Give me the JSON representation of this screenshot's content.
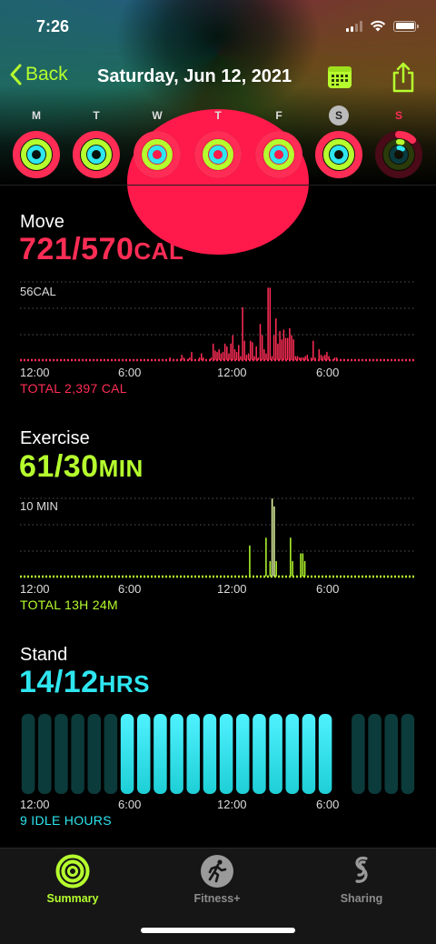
{
  "status_bar": {
    "time": "7:26"
  },
  "nav": {
    "back_label": "Back",
    "title": "Saturday, Jun 12, 2021"
  },
  "week": {
    "days": [
      {
        "letter": "M",
        "state": "complete"
      },
      {
        "letter": "T",
        "state": "complete"
      },
      {
        "letter": "W",
        "state": "complete"
      },
      {
        "letter": "T",
        "state": "complete"
      },
      {
        "letter": "F",
        "state": "complete"
      },
      {
        "letter": "S",
        "state": "selected"
      },
      {
        "letter": "S",
        "state": "today"
      }
    ]
  },
  "move": {
    "title": "Move",
    "value": "721/570",
    "unit": "CAL",
    "scale_label": "56CAL",
    "total": "TOTAL 2,397 CAL",
    "x_ticks": [
      "12:00",
      "6:00",
      "12:00",
      "6:00"
    ],
    "color": "#ff2d55"
  },
  "exercise": {
    "title": "Exercise",
    "value": "61/30",
    "unit": "MIN",
    "scale_label": "10 MIN",
    "total": "TOTAL 13H 24M",
    "x_ticks": [
      "12:00",
      "6:00",
      "12:00",
      "6:00"
    ],
    "color": "#b6ff2e"
  },
  "stand": {
    "title": "Stand",
    "value": "14/12",
    "unit": "HRS",
    "idle": "9 IDLE HOURS",
    "x_ticks": [
      "12:00",
      "6:00",
      "12:00",
      "6:00"
    ],
    "color": "#2ee6f0"
  },
  "chart_data": [
    {
      "type": "bar",
      "name": "Move",
      "unit": "CAL",
      "interval_minutes": 15,
      "ylim": [
        0,
        56
      ],
      "values": [
        0,
        0,
        0,
        0,
        0,
        0,
        0,
        0,
        0,
        0,
        0,
        0,
        0,
        0,
        0,
        0,
        0,
        0,
        0,
        0,
        0,
        0,
        0,
        0,
        0,
        0,
        0,
        0,
        0,
        0,
        0,
        0,
        0,
        0,
        0,
        0,
        0,
        0,
        0,
        0,
        0,
        0,
        0,
        0,
        0,
        0,
        0,
        0,
        0,
        0,
        0,
        0,
        0,
        0,
        0,
        0,
        0,
        0,
        0,
        0,
        0,
        0,
        0,
        0,
        0,
        0,
        0,
        0,
        0,
        0,
        0,
        0,
        0,
        1,
        1,
        1,
        2,
        0,
        0,
        1,
        1,
        1,
        4,
        2,
        1,
        1,
        2,
        6,
        1,
        0,
        0,
        2,
        5,
        2,
        1,
        1,
        1,
        2,
        12,
        7,
        6,
        8,
        5,
        6,
        12,
        10,
        5,
        12,
        18,
        8,
        6,
        11,
        3,
        38,
        14,
        4,
        5,
        14,
        13,
        3,
        10,
        2,
        26,
        18,
        8,
        5,
        52,
        52,
        3,
        18,
        30,
        12,
        21,
        15,
        22,
        16,
        16,
        23,
        18,
        15,
        3,
        3,
        2,
        2,
        2,
        3,
        4,
        1,
        2,
        14,
        2,
        1,
        8,
        4,
        3,
        4,
        6,
        3,
        1,
        1,
        2,
        2,
        1,
        1,
        1,
        1,
        1,
        1,
        1,
        1,
        1,
        1,
        1,
        1,
        1,
        1,
        1,
        1,
        1,
        1,
        1,
        1,
        1,
        1,
        1,
        1,
        1,
        1,
        1,
        1,
        1,
        1,
        1,
        1,
        1,
        1,
        1,
        1,
        1,
        1,
        1,
        1
      ],
      "x_ticks": [
        "12:00",
        "6:00",
        "12:00",
        "6:00"
      ]
    },
    {
      "type": "bar",
      "name": "Exercise",
      "unit": "MIN",
      "interval_minutes": 15,
      "ylim": [
        0,
        10
      ],
      "values": [
        0,
        0,
        0,
        0,
        0,
        0,
        0,
        0,
        0,
        0,
        0,
        0,
        0,
        0,
        0,
        0,
        0,
        0,
        0,
        0,
        0,
        0,
        0,
        0,
        0,
        0,
        0,
        0,
        0,
        0,
        0,
        0,
        0,
        0,
        0,
        0,
        0,
        0,
        0,
        0,
        0,
        0,
        0,
        0,
        0,
        0,
        0,
        0,
        0,
        0,
        0,
        0,
        0,
        0,
        0,
        0,
        0,
        0,
        0,
        0,
        0,
        0,
        0,
        0,
        0,
        0,
        0,
        0,
        0,
        0,
        0,
        0,
        0,
        0,
        0,
        0,
        0,
        0,
        0,
        0,
        0,
        0,
        0,
        0,
        0,
        0,
        0,
        0,
        0,
        0,
        0,
        0,
        0,
        0,
        0,
        0,
        0,
        0,
        0,
        0,
        0,
        0,
        0,
        0,
        0,
        0,
        0,
        0,
        0,
        0,
        0,
        0,
        4,
        1,
        0,
        0,
        0,
        0,
        0,
        0,
        5,
        0,
        2,
        10,
        9,
        2,
        0,
        0,
        0,
        0,
        0,
        0,
        5,
        2,
        0,
        0,
        0,
        3,
        3,
        2,
        0,
        0,
        0,
        0,
        0,
        0,
        0,
        0,
        0,
        0,
        0,
        1,
        1,
        1,
        0,
        1,
        0,
        0,
        0,
        0,
        0,
        0,
        0,
        0,
        0,
        0,
        0,
        0,
        0,
        0,
        0,
        0,
        0,
        0,
        0,
        0,
        0,
        0,
        0,
        0,
        0,
        0,
        0,
        0,
        0,
        0,
        0,
        0,
        0,
        0,
        0,
        0,
        0,
        0
      ],
      "x_ticks": [
        "12:00",
        "6:00",
        "12:00",
        "6:00"
      ]
    },
    {
      "type": "bar",
      "name": "Stand",
      "unit": "HRS",
      "hours": [
        0,
        1,
        2,
        3,
        4,
        5,
        6,
        7,
        8,
        9,
        10,
        11,
        12,
        13,
        14,
        15,
        16,
        17,
        18,
        19,
        20,
        21,
        22,
        23
      ],
      "stood": [
        0,
        0,
        0,
        0,
        0,
        0,
        1,
        1,
        1,
        1,
        1,
        1,
        1,
        1,
        1,
        1,
        1,
        1,
        1,
        1,
        0,
        0,
        0,
        0
      ],
      "visible": [
        1,
        1,
        1,
        1,
        1,
        1,
        1,
        1,
        1,
        1,
        1,
        1,
        1,
        1,
        1,
        1,
        1,
        1,
        1,
        0,
        1,
        1,
        1,
        1
      ],
      "x_ticks": [
        "12:00",
        "6:00",
        "12:00",
        "6:00"
      ]
    }
  ],
  "tabs": [
    {
      "label": "Summary",
      "icon": "activity-rings-icon",
      "active": true
    },
    {
      "label": "Fitness+",
      "icon": "running-figure-icon",
      "active": false
    },
    {
      "label": "Sharing",
      "icon": "sharing-icon",
      "active": false
    }
  ]
}
